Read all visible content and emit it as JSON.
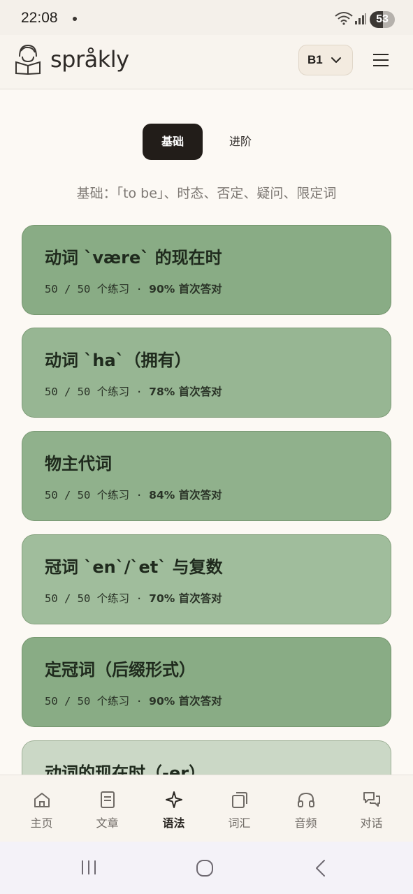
{
  "status_bar": {
    "time": "22:08",
    "battery": "53",
    "battery_level": 0.53
  },
  "header": {
    "brand": "språkly",
    "level": "B1",
    "icons": {
      "logo": "reading-person-icon",
      "chevron": "chevron-down-icon",
      "menu": "hamburger-menu-icon"
    }
  },
  "tabs": [
    {
      "label": "基础",
      "active": true
    },
    {
      "label": "进阶",
      "active": false
    }
  ],
  "subtitle": "基础：「to be」、时态、否定、疑问、限定词",
  "lessons": [
    {
      "title": "动词 `være` 的现在时",
      "progress": "50 / 50 个练习 · ",
      "score": "90% 首次答对",
      "color": "#89ac85"
    },
    {
      "title": "动词 `ha`（拥有）",
      "progress": "50 / 50 个练习 · ",
      "score": "78% 首次答对",
      "color": "#97b693"
    },
    {
      "title": "物主代词",
      "progress": "50 / 50 个练习 · ",
      "score": "84% 首次答对",
      "color": "#90b18c"
    },
    {
      "title": "冠词 `en`/`et` 与复数",
      "progress": "50 / 50 个练习 · ",
      "score": "70% 首次答对",
      "color": "#a0bd9c"
    },
    {
      "title": "定冠词（后缀形式）",
      "progress": "50 / 50 个练习 · ",
      "score": "90% 首次答对",
      "color": "#89ac85"
    },
    {
      "title": "动词的现在时（-er）",
      "progress": "",
      "score": "",
      "color": "#cbd8c6"
    }
  ],
  "bottom_nav": [
    {
      "label": "主页",
      "icon": "home-icon",
      "active": false
    },
    {
      "label": "文章",
      "icon": "document-icon",
      "active": false
    },
    {
      "label": "语法",
      "icon": "sparkle-icon",
      "active": true
    },
    {
      "label": "词汇",
      "icon": "cards-icon",
      "active": false
    },
    {
      "label": "音频",
      "icon": "headphones-icon",
      "active": false
    },
    {
      "label": "对话",
      "icon": "chat-icon",
      "active": false
    }
  ],
  "system_nav": {
    "icons": [
      "recents-icon",
      "home-circle-icon",
      "back-icon"
    ]
  }
}
